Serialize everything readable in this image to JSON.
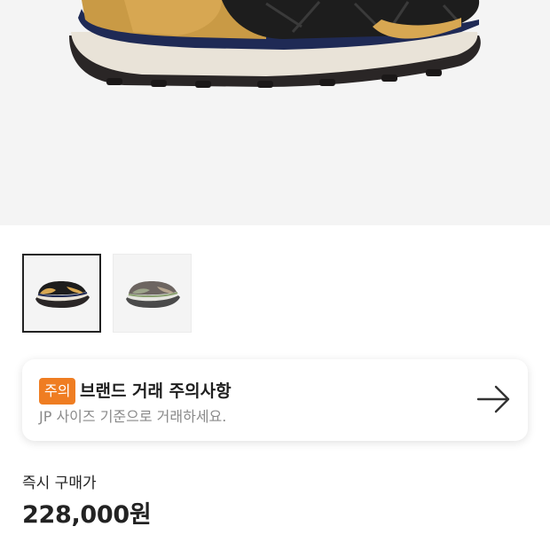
{
  "product": {
    "images": [
      {
        "name": "shoe-image-1",
        "selected": true,
        "colorway": "black-mustard"
      },
      {
        "name": "shoe-image-2",
        "selected": false,
        "colorway": "grey-olive"
      }
    ]
  },
  "notice": {
    "badge": "주의",
    "title": "브랜드 거래 주의사항",
    "subtitle": "JP 사이즈 기준으로 거래하세요.",
    "arrow_icon": "arrow-right-icon"
  },
  "price": {
    "label": "즉시 구매가",
    "value": "228,000원"
  },
  "colors": {
    "badge": "#ef7d22",
    "hero_bg": "#f4f4f4"
  }
}
